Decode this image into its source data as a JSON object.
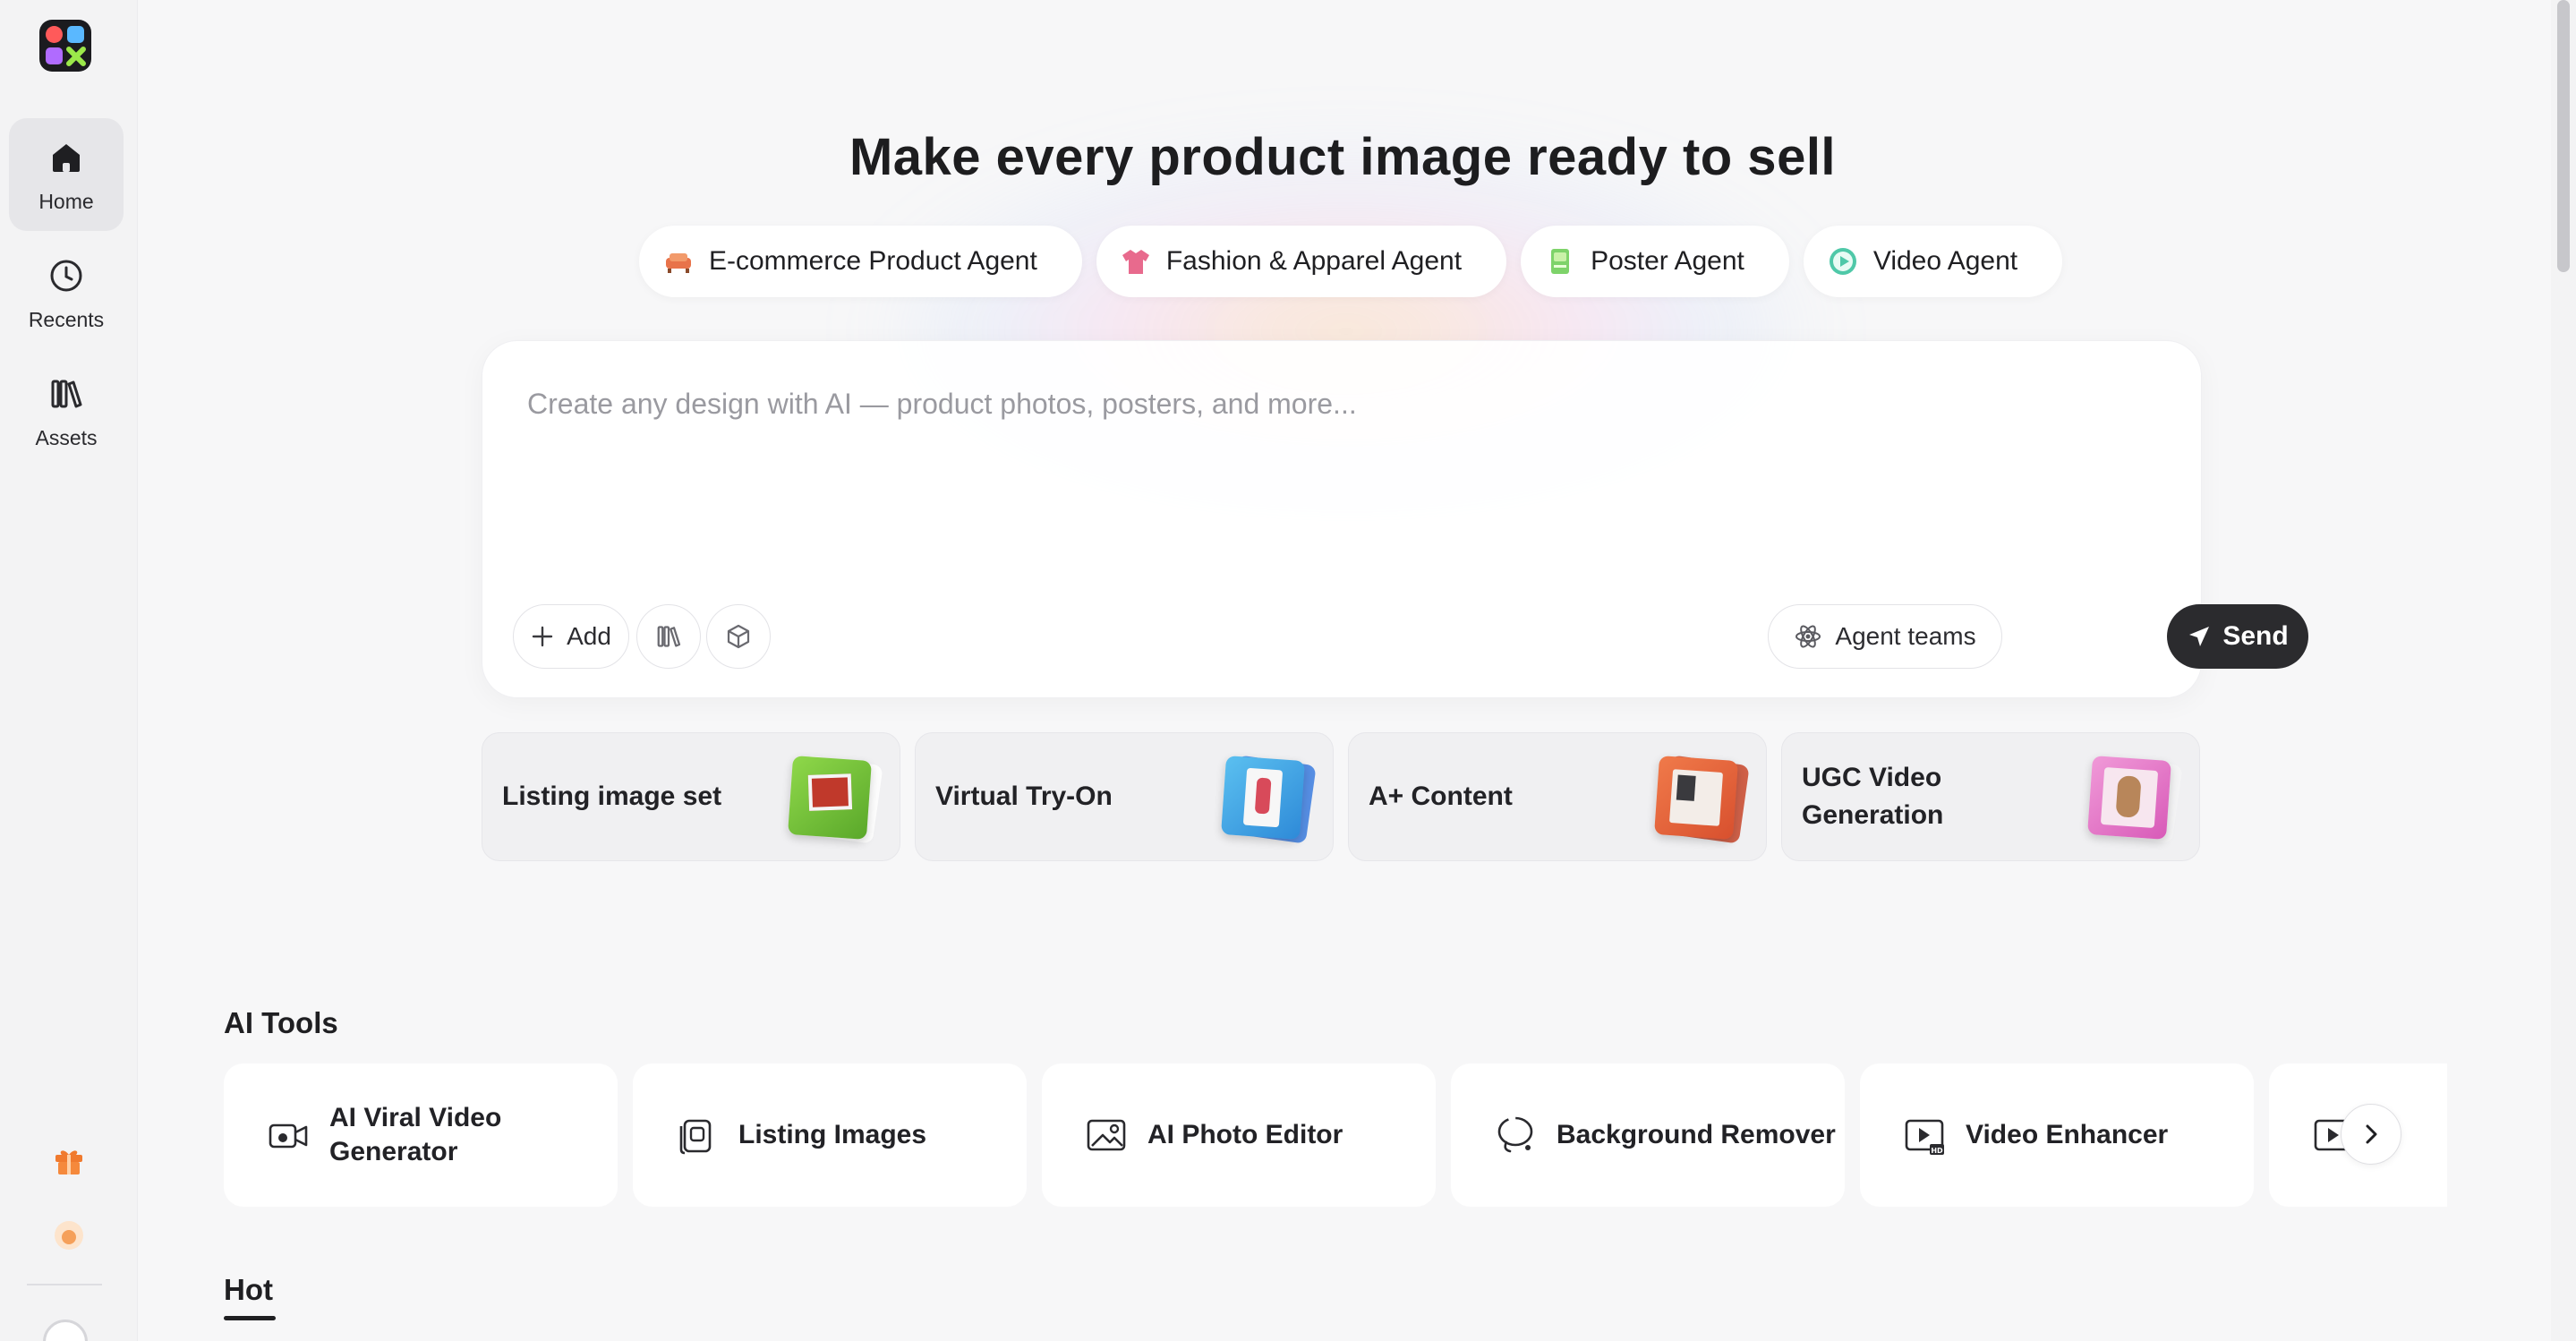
{
  "sidebar": {
    "items": [
      {
        "label": "Home",
        "active": true,
        "icon": "home-icon"
      },
      {
        "label": "Recents",
        "active": false,
        "icon": "clock-icon"
      },
      {
        "label": "Assets",
        "active": false,
        "icon": "library-icon"
      }
    ],
    "bottom_icons": [
      "gift-icon",
      "credits-icon",
      "avatar"
    ]
  },
  "hero": {
    "headline": "Make every product image ready to sell",
    "agents": [
      {
        "label": "E-commerce Product Agent",
        "icon": "sofa-icon",
        "color": "#e8734a"
      },
      {
        "label": "Fashion & Apparel Agent",
        "icon": "shirt-icon",
        "color": "#e86a8d"
      },
      {
        "label": "Poster Agent",
        "icon": "poster-icon",
        "color": "#7ed36a"
      },
      {
        "label": "Video Agent",
        "icon": "play-icon",
        "color": "#4fc8a8"
      }
    ]
  },
  "prompt": {
    "placeholder": "Create any design with AI — product photos, posters, and more...",
    "add_label": "Add",
    "agent_teams_label": "Agent teams",
    "send_label": "Send"
  },
  "quick_cards": [
    {
      "title": "Listing image set",
      "color": "#7cc43c"
    },
    {
      "title": "Virtual Try-On",
      "color": "#4aa8e8"
    },
    {
      "title": "A+ Content",
      "color": "#e0603c"
    },
    {
      "title": "UGC Video Generation",
      "color": "#e07ac8"
    }
  ],
  "ai_tools": {
    "title": "AI Tools",
    "items": [
      {
        "label": "AI Viral Video Generator",
        "icon": "video-camera-icon"
      },
      {
        "label": "Listing Images",
        "icon": "listing-icon"
      },
      {
        "label": "AI Photo Editor",
        "icon": "photo-icon"
      },
      {
        "label": "Background Remover",
        "icon": "lasso-icon"
      },
      {
        "label": "Video Enhancer",
        "icon": "hd-video-icon"
      },
      {
        "label": "",
        "icon": "video-icon"
      }
    ]
  },
  "hot": {
    "title": "Hot"
  },
  "help_label": "?"
}
